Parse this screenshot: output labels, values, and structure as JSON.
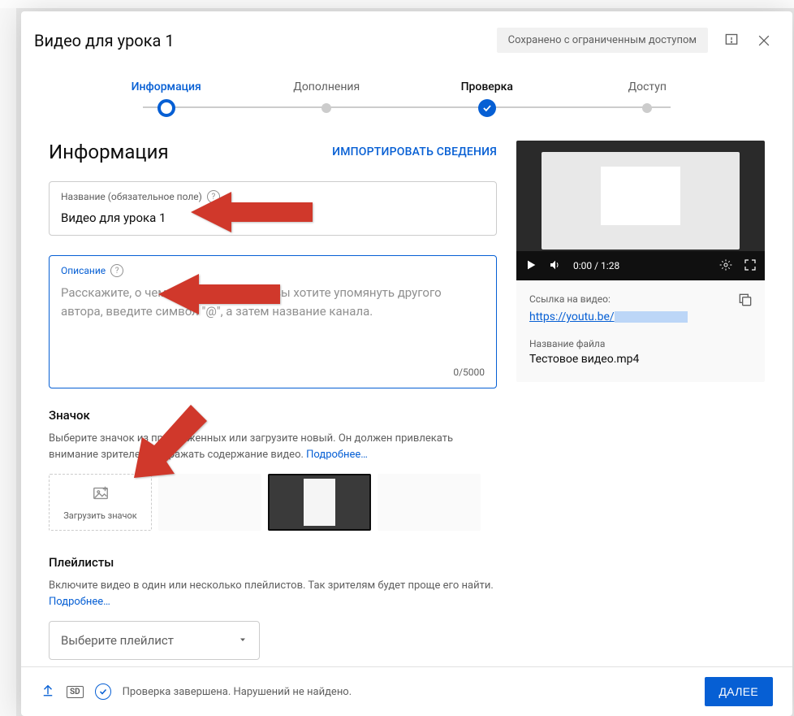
{
  "header": {
    "title": "Видео для урока 1",
    "save_status": "Сохранено с ограниченным доступом"
  },
  "stepper": {
    "steps": [
      {
        "label": "Информация"
      },
      {
        "label": "Дополнения"
      },
      {
        "label": "Проверка"
      },
      {
        "label": "Доступ"
      }
    ]
  },
  "info": {
    "heading": "Информация",
    "import_label": "ИМПОРТИРОВАТЬ СВЕДЕНИЯ",
    "title_label": "Название (обязательное поле)",
    "title_value": "Видео для урока 1",
    "desc_label": "Описание",
    "desc_placeholder": "Расскажите, о чем ваше видео. Если вы хотите упомянуть другого автора, введите символ \"@\", а затем название канала.",
    "char_count": "0/5000"
  },
  "thumb": {
    "heading": "Значок",
    "desc_text": "Выберите значок из предложенных или загрузите новый. Он должен привлекать внимание зрителей и отражать содержание видео. ",
    "more": "Подробнее…",
    "upload_label": "Загрузить значок"
  },
  "playlist": {
    "heading": "Плейлисты",
    "desc_text": "Включите видео в один или несколько плейлистов. Так зрителям будет проще его найти. ",
    "more": "Подробнее…",
    "select_label": "Выберите плейлист"
  },
  "preview": {
    "time": "0:00 / 1:28",
    "link_label": "Ссылка на видео:",
    "link_url": "https://youtu.be/",
    "file_label": "Название файла",
    "file_name": "Тестовое видео.mp4"
  },
  "footer": {
    "sd": "SD",
    "status": "Проверка завершена. Нарушений не найдено.",
    "next": "ДАЛЕЕ"
  },
  "icons": {
    "help": "?"
  },
  "colors": {
    "accent": "#065fd4",
    "arrow": "#d0382b"
  }
}
